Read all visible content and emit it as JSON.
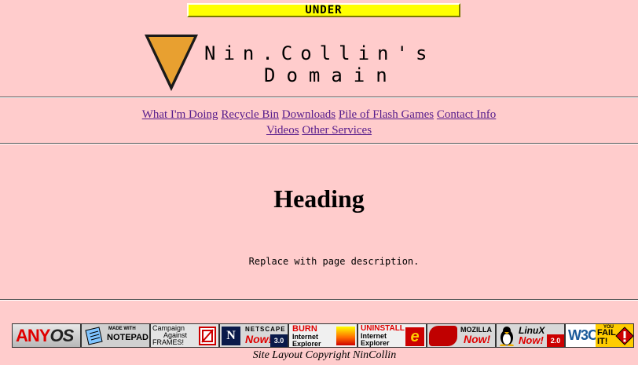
{
  "banner": {
    "text": "Under"
  },
  "logo": {
    "title_line1": "Nin.Collin's",
    "title_line2": "Domain",
    "triangle_color": "#e8a030"
  },
  "nav": {
    "links": [
      "What I'm Doing",
      "Recycle Bin",
      "Downloads",
      "Pile of Flash Games",
      "Contact Info",
      "Videos",
      "Other Services"
    ]
  },
  "main": {
    "heading": "Heading",
    "description": "Replace with page description."
  },
  "badges": {
    "anyos": {
      "any": "ANY",
      "os": "OS"
    },
    "notepad": {
      "small": "MADE WITH",
      "big": "NOTEPAD"
    },
    "frames": {
      "line1": "Campaign",
      "line2": "Against",
      "line3": "FRAMES!"
    },
    "netscape": {
      "label": "NETSCAPE",
      "now": "Now!",
      "version": "3.0"
    },
    "burn": {
      "line1": "BURN",
      "line2": "Internet",
      "line3": "Explorer"
    },
    "uninstall": {
      "line1": "UNINSTALL",
      "line2": "Internet",
      "line3": "Explorer"
    },
    "mozilla": {
      "label": "MOZILLA",
      "now": "Now!"
    },
    "linux": {
      "label": "LinuX",
      "now": "Now!",
      "version": "2.0"
    },
    "w3c": {
      "logo": "W3C",
      "you": "YOU",
      "fail": "FAIL",
      "it": "IT!"
    }
  },
  "footer": {
    "copyright": "Site Layout Copyright NinCollin"
  },
  "colors": {
    "background": "#ffcccc",
    "banner": "#ffff00",
    "link": "#551a8b"
  }
}
